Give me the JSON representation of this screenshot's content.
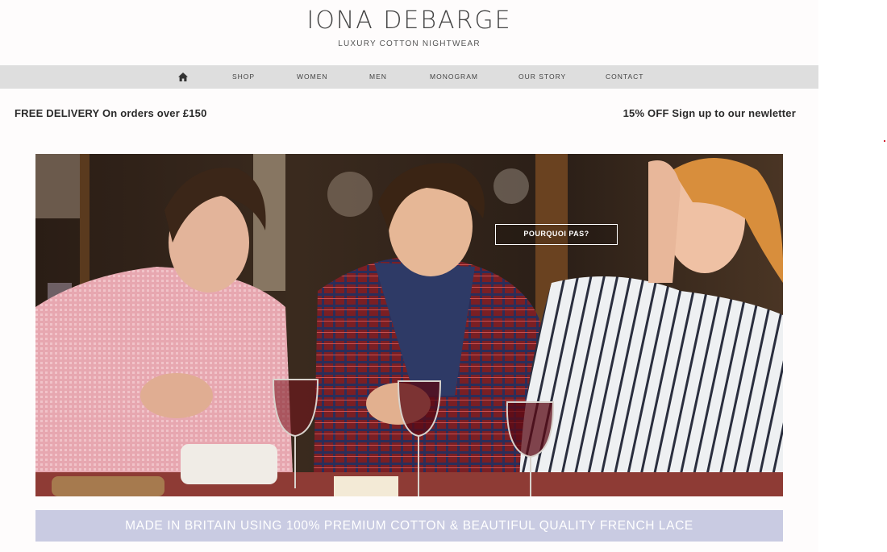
{
  "header": {
    "brand_name": "IONA DEBARGE",
    "tagline": "LUXURY COTTON NIGHTWEAR"
  },
  "nav": {
    "home_icon": "home-icon",
    "items": [
      {
        "label": "SHOP"
      },
      {
        "label": "WOMEN"
      },
      {
        "label": "MEN"
      },
      {
        "label": "MONOGRAM"
      },
      {
        "label": "OUR STORY"
      },
      {
        "label": "CONTACT"
      }
    ]
  },
  "promos": {
    "left": "FREE DELIVERY On orders over £150",
    "right": "15% OFF Sign up to our newletter"
  },
  "hero": {
    "button_label": "POURQUOI PAS?"
  },
  "banner": {
    "text": "MADE IN BRITAIN USING 100% PREMIUM COTTON & BEAUTIFUL QUALITY FRENCH LACE"
  },
  "colors": {
    "nav_bg": "#dedede",
    "banner_bg": "#c9cbe2",
    "text_dark": "#2a2a2a"
  }
}
